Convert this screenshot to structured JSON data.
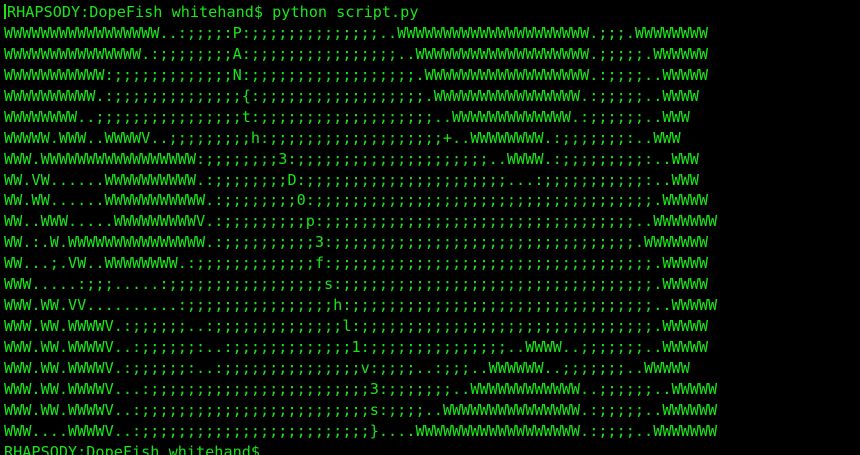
{
  "terminal": {
    "text_color": "#19e619",
    "background_color": "#000000",
    "command_line": "RHAPSODY:DopeFish whitehand$ python script.py",
    "output_lines": [
      "WWWWWWWWWWWWWWWWW..:;;;;:P:;;;;;;;;;;;;;;..WWWWWWWWWWWWWWWWWWWWW.;;;.WWWWWWWW",
      "WWWWWWWWWWWWWWW.:;;;;;;;;A:;;;;;;;;;;;;;;;;..WWWWWWWWWWWWWWWWWWW.;;;;;.WWWWWW",
      "WWWWWWWWWWW:;;;;;;;;;;;;;N:;;;;;;;;;;;;;;;;;;.WWWWWWWWWWWWWWWWWW.:;;;;..WWWWW",
      "WWWWWWWWWW.:;;;;;;;;;;;;;;{:;;;;;;;;;;;;;;;;;;.WWWWWWWWWWWWWWWW.:;;;;;..WWWW",
      "WWWWWWWW..;;;;;;;;;;;;;;;;t:;;;;;;;;;;;;;;;;;;;..WWWWWWWWWWWWW.:;;;;;;..WWW",
      "WWWWW.WWW..WWWWV..;;;;;;;;;h:;;;;;;;;;;;;;;;;;;;+..WWWWWWWW.:;;;;;;;:..WWW",
      "WWW.WWWWWWWWWWWWWWWWW:;;;;;;;;3:;;;;;;;;;;;;;;;;;;;;;..WWWW.:;;;;;;;;;:..WWW",
      "WW.VW......WWWWWWWWWW.:;;;;;;;;D:;;;;;;;;;;;;;;;;;;;;;;...:;;;;;;;;;;;:..WWW",
      "WW.WW......WWWWWWWWWWW.:;;;;;;;;0:;;;;;;;;;;;;;;;;;;;;;;;;;;;;;;;;;;;;;.WWWWW",
      "WW..WWW.....WWWWWWWWWV.:;;;;;;;;;p:;;;;;;;;;;;;;;;;;;;;;;;;;;;;;;;;;;..WWWWWWW",
      "WW.:.W.WWWWWWWWWWWWWWW.:;;;;;;;;;;3:;;;;;;;;;;;;;;;;;;;;;;;;;;;;;;;;;.WWWWWWW",
      "WW...;.VW..WWWWWWWW.:;;;;;;;;;;;;;f:;;;;;;;;;;;;;;;;;;;;;;;;;;;;;;;;;;;.WWWWW",
      "WWW.....:;;;.....:;;;;;;;;;;;;;;;;;s:;;;;;;;;;;;;;;;;;;;;;;;;;;;;;;;;;;.WWWWW",
      "WWW.WW.VV..........:;;;;;;;;;;;;;;;;h:;;;;;;;;;;;;;;;;;;;;;;;;;;;;;;;;;..WWWWW",
      "WWW.WW.WWWWV.:;;;;;;..:;;;;;;;;;;;;;;l:;;;;;;;;;;;;;;;;;;;;;;;;;;;;;;;;.WWWWW",
      "WWW.WW.WWWWV..:;;;;;;:..:;;;;;;;;;;;;;1:;;;;;;;;;;;;;;;..WWWW..;;;;;;;..WWWWW",
      "WWW.WW.WWWWV.:;;;;;;:..:;;;;;;;;;;;;;;;v:;;;;..:;;;..WWWWWW..;;;;;;;..WWWWW",
      "WWW.WW.WWWWV...:;;;;;;;;;;;;;;;;;;;;;;;;3:;;;;;;;..WWWWWWWWWWWW..;;;;;;..WWWWW",
      "WWW.WW.WWWWV..:;;;;;;;;;;;;;;;;;;;;;;;;;s:;;;;..WWWWWWWWWWWWWWW.:;;;;;..WWWWWW",
      "WWW....WWWWV..:;;;;;;;;;;;;;;;;;;;;;;;;;}....WWWWWWWWWWWWWWWWWW.:;;;;..WWWWWWW"
    ],
    "prompt_line": "RHAPSODY:DopeFish whitehand$"
  }
}
